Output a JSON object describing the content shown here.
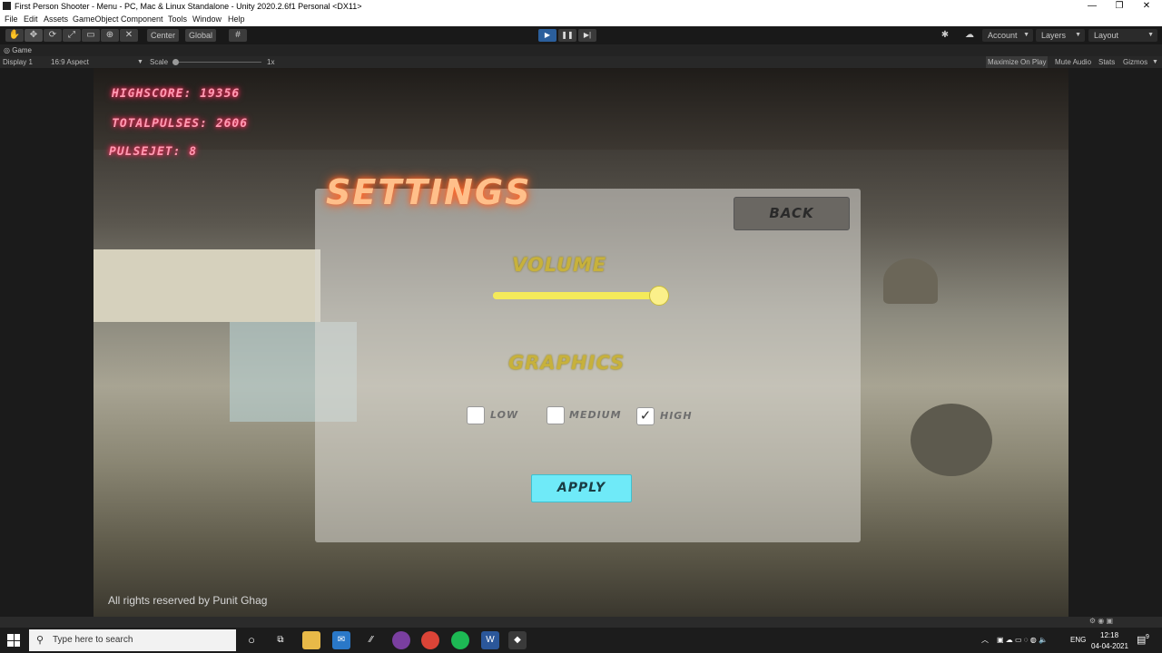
{
  "window": {
    "title": "First Person Shooter - Menu - PC, Mac & Linux Standalone - Unity 2020.2.6f1 Personal <DX11>",
    "minimize": "—",
    "restore": "❐",
    "close": "✕"
  },
  "menu": [
    "File",
    "Edit",
    "Assets",
    "GameObject",
    "Component",
    "Tools",
    "Window",
    "Help"
  ],
  "toolbar": {
    "center_label": "Center",
    "global_label": "Global",
    "account_label": "Account",
    "layers_label": "Layers",
    "layout_label": "Layout",
    "play_icon": "▶",
    "pause_icon": "❚❚",
    "step_icon": "▶|"
  },
  "tab": {
    "label": "Game"
  },
  "gamebar": {
    "display": "Display 1",
    "aspect": "16:9 Aspect",
    "scale_label": "Scale",
    "scale_value": "1x",
    "maximize": "Maximize On Play",
    "mute": "Mute Audio",
    "stats": "Stats",
    "gizmos": "Gizmos"
  },
  "hud": {
    "highscore": "HIGHSCORE: 19356",
    "totalpulses": "TOTALPULSES: 2606",
    "pulsejet": "PULSEJET: 8"
  },
  "settings": {
    "title": "SETTINGS",
    "back_label": "BACK",
    "volume_label": "VOLUME",
    "volume_level": 1.0,
    "graphics_label": "GRAPHICS",
    "options": [
      {
        "label": "LOW",
        "checked": false
      },
      {
        "label": "MEDIUM",
        "checked": false
      },
      {
        "label": "HIGH",
        "checked": true
      }
    ],
    "check_mark": "✓",
    "apply_label": "APPLY"
  },
  "footer": {
    "copyright": "All rights reserved by Punit Ghag"
  },
  "taskbar": {
    "search_placeholder": "Type here to search",
    "lang": "ENG",
    "time": "12:18",
    "date": "04-04-2021",
    "notification_count": "9"
  },
  "colors": {
    "hud_glow": "#ff2a5a",
    "title_glow": "#ff6a2a",
    "section_label": "#c7b13c",
    "slider": "#f4ea5a",
    "apply": "#6feaf8",
    "play_active": "#2b5f9c"
  }
}
